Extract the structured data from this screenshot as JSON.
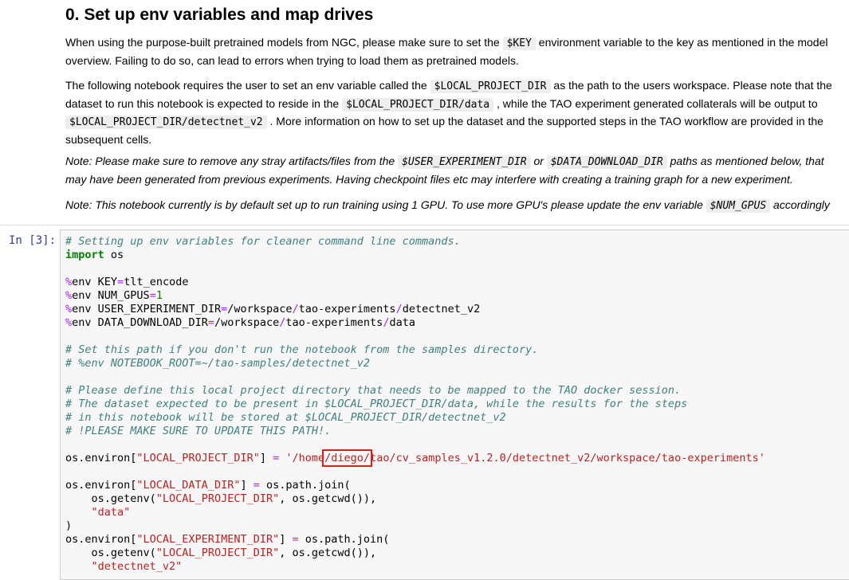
{
  "heading": "0. Set up env variables and map drives",
  "p1": {
    "pre": "When using the purpose-built pretrained models from NGC, please make sure to set the ",
    "code": "$KEY",
    "post": " environment variable to the key as mentioned in the model overview. Failing to do so, can lead to errors when trying to load them as pretrained models."
  },
  "p2": {
    "t1": "The following notebook requires the user to set an env variable called the ",
    "c1": "$LOCAL_PROJECT_DIR",
    "t2": " as the path to the users workspace. Please note that the dataset to run this notebook is expected to reside in the ",
    "c2": "$LOCAL_PROJECT_DIR/data",
    "t3": " , while the TAO experiment generated collaterals will be output to ",
    "c3": "$LOCAL_PROJECT_DIR/detectnet_v2",
    "t4": " . More information on how to set up the dataset and the supported steps in the TAO workflow are provided in the subsequent cells."
  },
  "p3": {
    "t1": "Note: Please make sure to remove any stray artifacts/files from the ",
    "c1": "$USER_EXPERIMENT_DIR",
    "t2": " or ",
    "c2": "$DATA_DOWNLOAD_DIR",
    "t3": " paths as mentioned below, that may have been generated from previous experiments. Having checkpoint files etc may interfere with creating a training graph for a new experiment."
  },
  "p4": {
    "t1": "Note: This notebook currently is by default set up to run training using 1 GPU. To use more GPU's please update the env variable ",
    "c1": "$NUM_GPUS",
    "t2": " accordingly"
  },
  "cell": {
    "prompt": "In [3]:",
    "c1": "# Setting up env variables for cleaner command line commands.",
    "imp_kw": "import",
    "imp_mod": " os",
    "env_pct": "%",
    "env1": "env KEY",
    "env1_op": "=",
    "env1_val": "tlt_encode",
    "env2": "env NUM_GPUS",
    "env2_op": "=",
    "env2_val": "1",
    "env3": "env USER_EXPERIMENT_DIR",
    "env3_op": "=",
    "env3_val_a": "/workspace",
    "env3_val_b": "tao-experiments",
    "env3_val_c": "detectnet_v2",
    "env4": "env DATA_DOWNLOAD_DIR",
    "env4_op": "=",
    "env4_val_a": "/workspace",
    "env4_val_b": "tao-experiments",
    "env4_val_c": "data",
    "slash": "/",
    "c2": "# Set this path if you don't run the notebook from the samples directory.",
    "c3": "# %env NOTEBOOK_ROOT=~/tao-samples/detectnet_v2",
    "c4": "# Please define this local project directory that needs to be mapped to the TAO docker session.",
    "c5": "# The dataset expected to be present in $LOCAL_PROJECT_DIR/data, while the results for the steps",
    "c6": "# in this notebook will be stored at $LOCAL_PROJECT_DIR/detectnet_v2",
    "c7": "# !PLEASE MAKE SURE TO UPDATE THIS PATH!.",
    "l1_a": "os.environ[",
    "l1_key": "\"LOCAL_PROJECT_DIR\"",
    "l1_b": "] ",
    "eq": "=",
    "l1_val_a": " '/home",
    "l1_val_hl": "/diego/",
    "l1_val_b": "tao/cv_samples_v1.2.0/detectnet_v2/workspace/tao-experiments'",
    "l2_a": "os.environ[",
    "l2_key": "\"LOCAL_DATA_DIR\"",
    "l2_b": "] ",
    "l2_c": " os.path.join(",
    "l3_a": "    os.getenv(",
    "l3_key": "\"LOCAL_PROJECT_DIR\"",
    "l3_b": ", os.getcwd()),",
    "l4_ind": "    ",
    "l4_val": "\"data\"",
    "l5": ")",
    "l6_a": "os.environ[",
    "l6_key": "\"LOCAL_EXPERIMENT_DIR\"",
    "l6_b": "] ",
    "l6_c": " os.path.join(",
    "l7_a": "    os.getenv(",
    "l7_key": "\"LOCAL_PROJECT_DIR\"",
    "l7_b": ", os.getcwd()),",
    "l8_ind": "    ",
    "l8_val": "\"detectnet_v2\""
  }
}
